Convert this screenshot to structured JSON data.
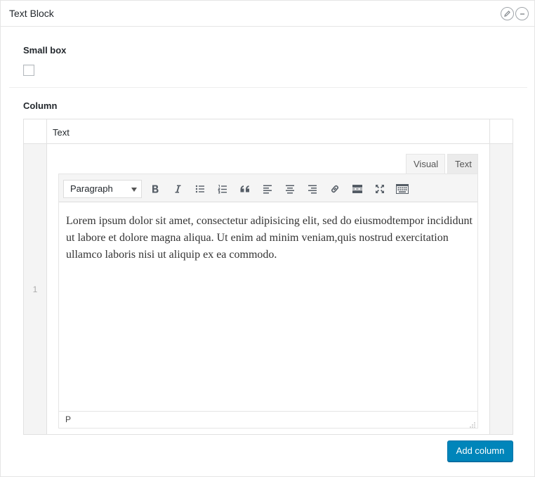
{
  "panel": {
    "title": "Text Block"
  },
  "fields": {
    "small_box_label": "Small box",
    "small_box_checked": false,
    "column_label": "Column"
  },
  "repeater": {
    "column_header": "Text",
    "row_number": "1"
  },
  "editor": {
    "tab_visual": "Visual",
    "tab_text": "Text",
    "format_selected": "Paragraph",
    "toolbar_icons": [
      "bold-icon",
      "italic-icon",
      "bullet-list-icon",
      "numbered-list-icon",
      "blockquote-icon",
      "align-left-icon",
      "align-center-icon",
      "align-right-icon",
      "link-icon",
      "read-more-icon",
      "fullscreen-icon",
      "toolbar-toggle-icon"
    ],
    "content": "Lorem ipsum dolor sit amet, consectetur adipisicing elit, sed do eiusmodtempor incididunt ut labore et dolore magna aliqua. Ut enim ad minim veniam,quis nostrud exercitation ullamco laboris nisi ut aliquip ex ea commodo.",
    "status_path": "P"
  },
  "actions": {
    "add_column": "Add column"
  },
  "colors": {
    "primary_button": "#0085ba",
    "border": "#e5e5e5"
  }
}
